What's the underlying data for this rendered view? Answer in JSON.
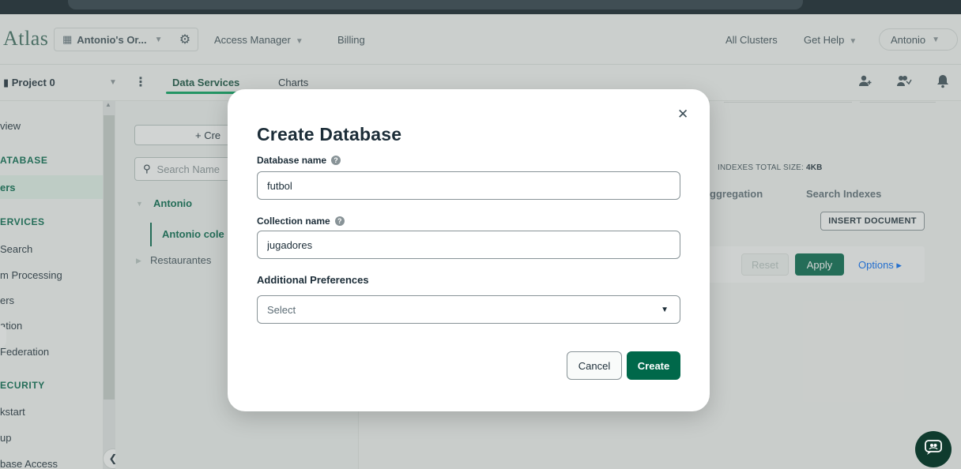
{
  "header": {
    "logo": "Atlas",
    "org_name": "Antonio's Or...",
    "access_manager": "Access Manager",
    "billing": "Billing",
    "all_clusters": "All Clusters",
    "get_help": "Get Help",
    "user": "Antonio"
  },
  "subheader": {
    "project": "Project 0",
    "tabs": [
      {
        "label": "Data Services",
        "active": true
      },
      {
        "label": "Charts",
        "active": false
      }
    ]
  },
  "sidebar": {
    "items": [
      {
        "label": "view",
        "kind": "item"
      },
      {
        "label": "ATABASE",
        "kind": "section"
      },
      {
        "label": "ers",
        "kind": "active"
      },
      {
        "label": "ERVICES",
        "kind": "section"
      },
      {
        "label": "Search",
        "kind": "item"
      },
      {
        "label": "m Processing",
        "kind": "item"
      },
      {
        "label": "ers",
        "kind": "item"
      },
      {
        "label": "ation",
        "kind": "item"
      },
      {
        "label": "Federation",
        "kind": "item"
      },
      {
        "label": "ECURITY",
        "kind": "section"
      },
      {
        "label": "kstart",
        "kind": "item"
      },
      {
        "label": "up",
        "kind": "item"
      },
      {
        "label": "base Access",
        "kind": "item"
      }
    ]
  },
  "middle": {
    "create_label": "+ Cre",
    "search_placeholder": "Search Name",
    "tree": {
      "database": "Antonio",
      "collection": "Antonio cole",
      "database2": "Restaurantes"
    }
  },
  "content": {
    "indexes_label": "INDEXES TOTAL SIZE:",
    "indexes_value": "4KB",
    "tabs": [
      "ggregation",
      "Search Indexes"
    ],
    "insert_document": "INSERT DOCUMENT",
    "reset": "Reset",
    "apply": "Apply",
    "options": "Options ▸"
  },
  "modal": {
    "title": "Create Database",
    "db_name_label": "Database name",
    "db_name_value": "futbol",
    "coll_name_label": "Collection name",
    "coll_name_value": "jugadores",
    "prefs_label": "Additional Preferences",
    "select_value": "Select",
    "cancel": "Cancel",
    "create": "Create"
  },
  "colors": {
    "primary_green": "#00684a",
    "accent_green": "#00a35c",
    "link_blue": "#016bf8",
    "dark_navy": "#0c1b24"
  }
}
